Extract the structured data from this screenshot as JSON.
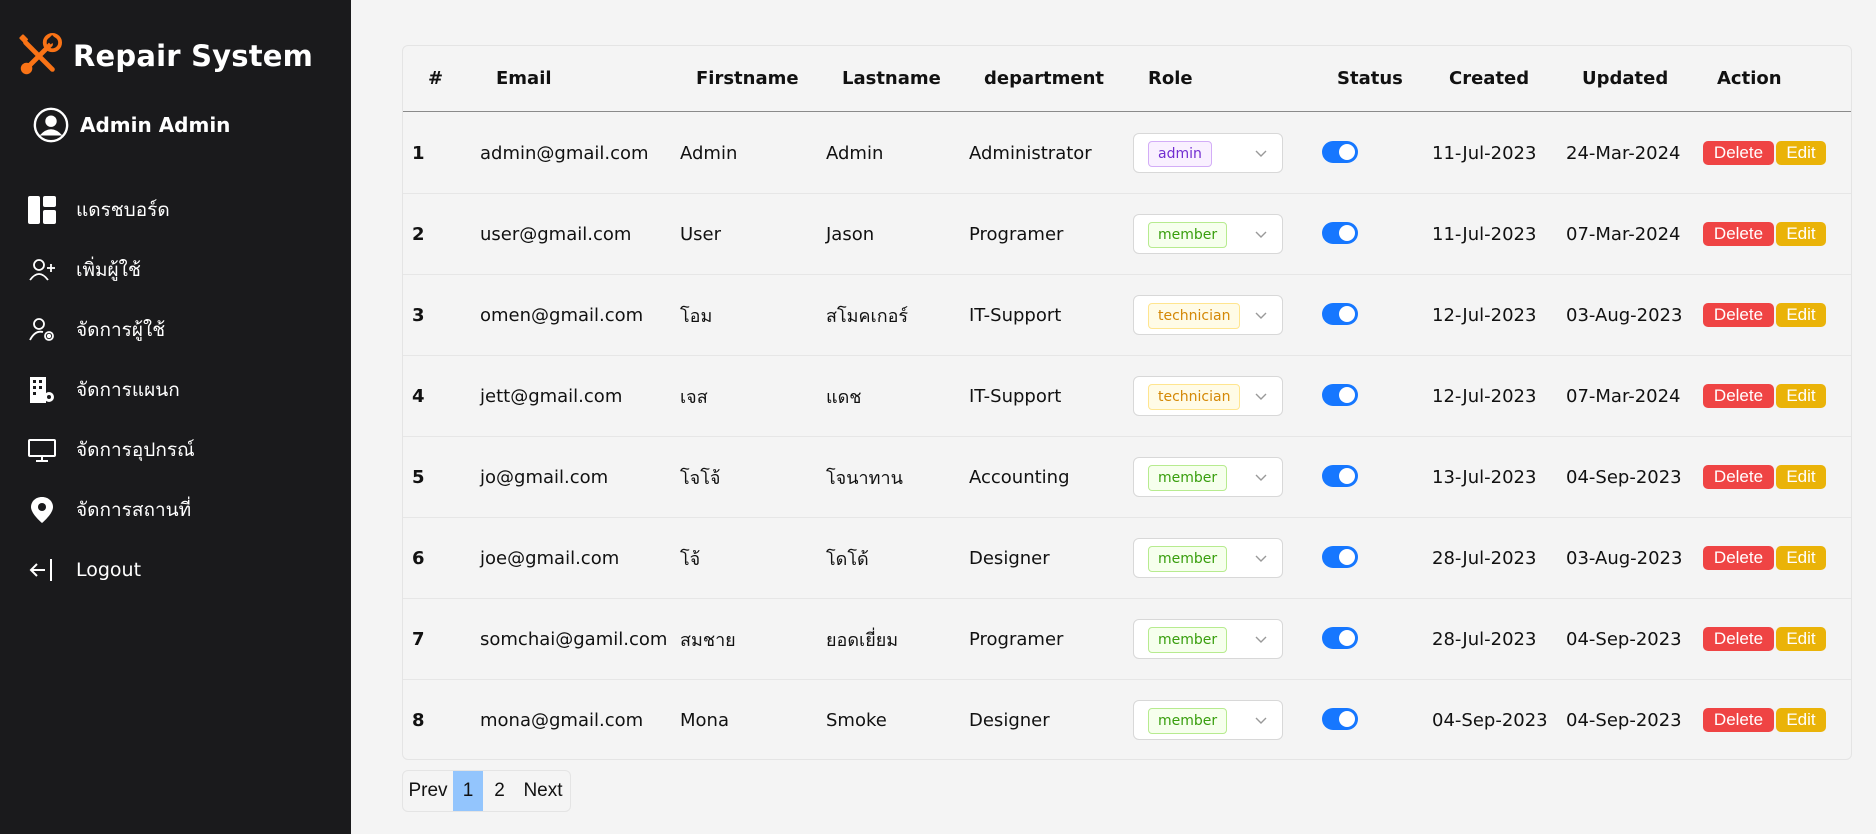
{
  "app": {
    "title": "Repair System",
    "logo_icon": "wrench-screwdriver-icon",
    "accent": "#f97316"
  },
  "user": {
    "name": "Admin Admin",
    "icon": "user-circle-icon"
  },
  "sidebar": {
    "items": [
      {
        "label": "แดรชบอร์ด",
        "icon": "dashboard-icon"
      },
      {
        "label": "เพิ่มผู้ใช้",
        "icon": "add-user-icon"
      },
      {
        "label": "จัดการผู้ใช้",
        "icon": "user-settings-icon"
      },
      {
        "label": "จัดการแผนก",
        "icon": "building-settings-icon"
      },
      {
        "label": "จัดการอุปกรณ์",
        "icon": "monitor-icon"
      },
      {
        "label": "จัดการสถานที่",
        "icon": "map-pin-icon"
      },
      {
        "label": "Logout",
        "icon": "logout-icon"
      }
    ]
  },
  "table": {
    "columns": [
      "#",
      "Email",
      "Firstname",
      "Lastname",
      "department",
      "Role",
      "Status",
      "Created",
      "Updated",
      "Action"
    ],
    "rows": [
      {
        "id": "1",
        "email": "admin@gmail.com",
        "firstname": "Admin",
        "lastname": "Admin",
        "department": "Administrator",
        "role": "admin",
        "status": true,
        "created": "11-Jul-2023",
        "updated": "24-Mar-2024"
      },
      {
        "id": "2",
        "email": "user@gmail.com",
        "firstname": "User",
        "lastname": "Jason",
        "department": "Programer",
        "role": "member",
        "status": true,
        "created": "11-Jul-2023",
        "updated": "07-Mar-2024"
      },
      {
        "id": "3",
        "email": "omen@gmail.com",
        "firstname": "โอม",
        "lastname": "สโมคเกอร์",
        "department": "IT-Support",
        "role": "technician",
        "status": true,
        "created": "12-Jul-2023",
        "updated": "03-Aug-2023"
      },
      {
        "id": "4",
        "email": "jett@gmail.com",
        "firstname": "เจส",
        "lastname": "แดช",
        "department": "IT-Support",
        "role": "technician",
        "status": true,
        "created": "12-Jul-2023",
        "updated": "07-Mar-2024"
      },
      {
        "id": "5",
        "email": "jo@gmail.com",
        "firstname": "โจโจ้",
        "lastname": "โจนาทาน",
        "department": "Accounting",
        "role": "member",
        "status": true,
        "created": "13-Jul-2023",
        "updated": "04-Sep-2023"
      },
      {
        "id": "6",
        "email": "joe@gmail.com",
        "firstname": "โจ้",
        "lastname": "โดโด้",
        "department": "Designer",
        "role": "member",
        "status": true,
        "created": "28-Jul-2023",
        "updated": "03-Aug-2023"
      },
      {
        "id": "7",
        "email": "somchai@gamil.com",
        "firstname": "สมชาย",
        "lastname": "ยอดเยี่ยม",
        "department": "Programer",
        "role": "member",
        "status": true,
        "created": "28-Jul-2023",
        "updated": "04-Sep-2023"
      },
      {
        "id": "8",
        "email": "mona@gmail.com",
        "firstname": "Mona",
        "lastname": "Smoke",
        "department": "Designer",
        "role": "member",
        "status": true,
        "created": "04-Sep-2023",
        "updated": "04-Sep-2023"
      }
    ],
    "actions": {
      "delete_label": "Delete",
      "edit_label": "Edit"
    }
  },
  "pagination": {
    "prev_label": "Prev",
    "pages": [
      "1",
      "2"
    ],
    "current_page": "1",
    "next_label": "Next"
  },
  "colors": {
    "delete": "#ef4444",
    "edit": "#eab308",
    "switch_on": "#1677ff",
    "active_page": "#93c5fd"
  }
}
